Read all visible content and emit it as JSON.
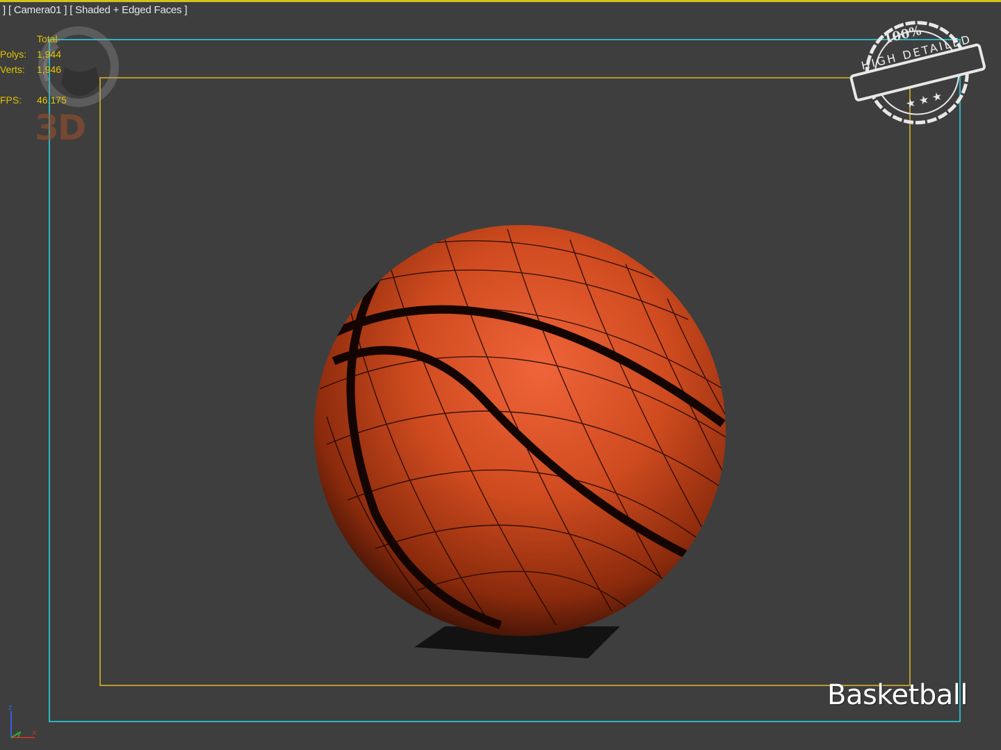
{
  "viewport": {
    "label_parts": [
      "]",
      "[ Camera01 ]",
      "[ Shaded + Edged Faces ]"
    ],
    "border_color": "#d4c21a"
  },
  "stats": {
    "header": "Total",
    "polys_label": "Polys:",
    "polys_value": "1,944",
    "verts_label": "Verts:",
    "verts_value": "1,946",
    "fps_label": "FPS:",
    "fps_value": "46.175",
    "color": "#e2c500"
  },
  "watermark": {
    "logo_text": "3D",
    "icon": "headphones-logo-icon"
  },
  "stamp": {
    "top_text": "100%",
    "band_text": "HIGH DETAILED",
    "icon": "stamp-badge-icon"
  },
  "model": {
    "caption": "Basketball",
    "icon": "basketball-model",
    "color": "#c8471e"
  },
  "axis": {
    "z": "z",
    "y": "y",
    "x": "x"
  },
  "frames": {
    "safe_outer_color": "#2bb6c4",
    "safe_inner_color": "#b99a2a"
  }
}
